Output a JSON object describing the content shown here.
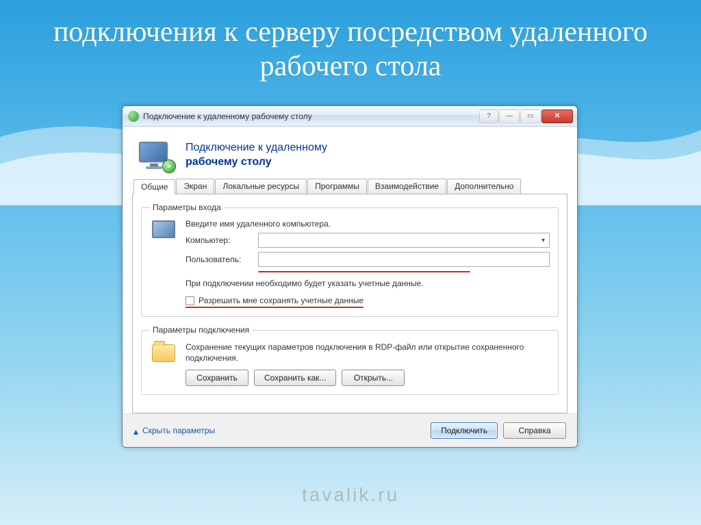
{
  "slide": {
    "title": "подключения к серверу посредством удаленного рабочего стола"
  },
  "window": {
    "title": "Подключение к удаленному рабочему столу",
    "header_line1": "Подключение к удаленному",
    "header_line2": "рабочему столу"
  },
  "tabs": {
    "general": "Общие",
    "display": "Экран",
    "local": "Локальные ресурсы",
    "programs": "Программы",
    "experience": "Взаимодействие",
    "advanced": "Дополнительно"
  },
  "login_group": {
    "legend": "Параметры входа",
    "instruction": "Введите имя удаленного компьютера.",
    "computer_label": "Компьютер:",
    "computer_value": "",
    "user_label": "Пользователь:",
    "user_value": "",
    "credentials_note": "При подключении необходимо будет указать учетные данные.",
    "save_creds_label": "Разрешить мне сохранять учетные данные"
  },
  "conn_group": {
    "legend": "Параметры подключения",
    "description": "Сохранение текущих параметров подключения в RDP-файл или открытие сохраненного подключения.",
    "save": "Сохранить",
    "save_as": "Сохранить как...",
    "open": "Открыть..."
  },
  "footer": {
    "hide_params": "Скрыть параметры",
    "connect": "Подключить",
    "help": "Справка"
  },
  "watermark": "tavalik.ru"
}
